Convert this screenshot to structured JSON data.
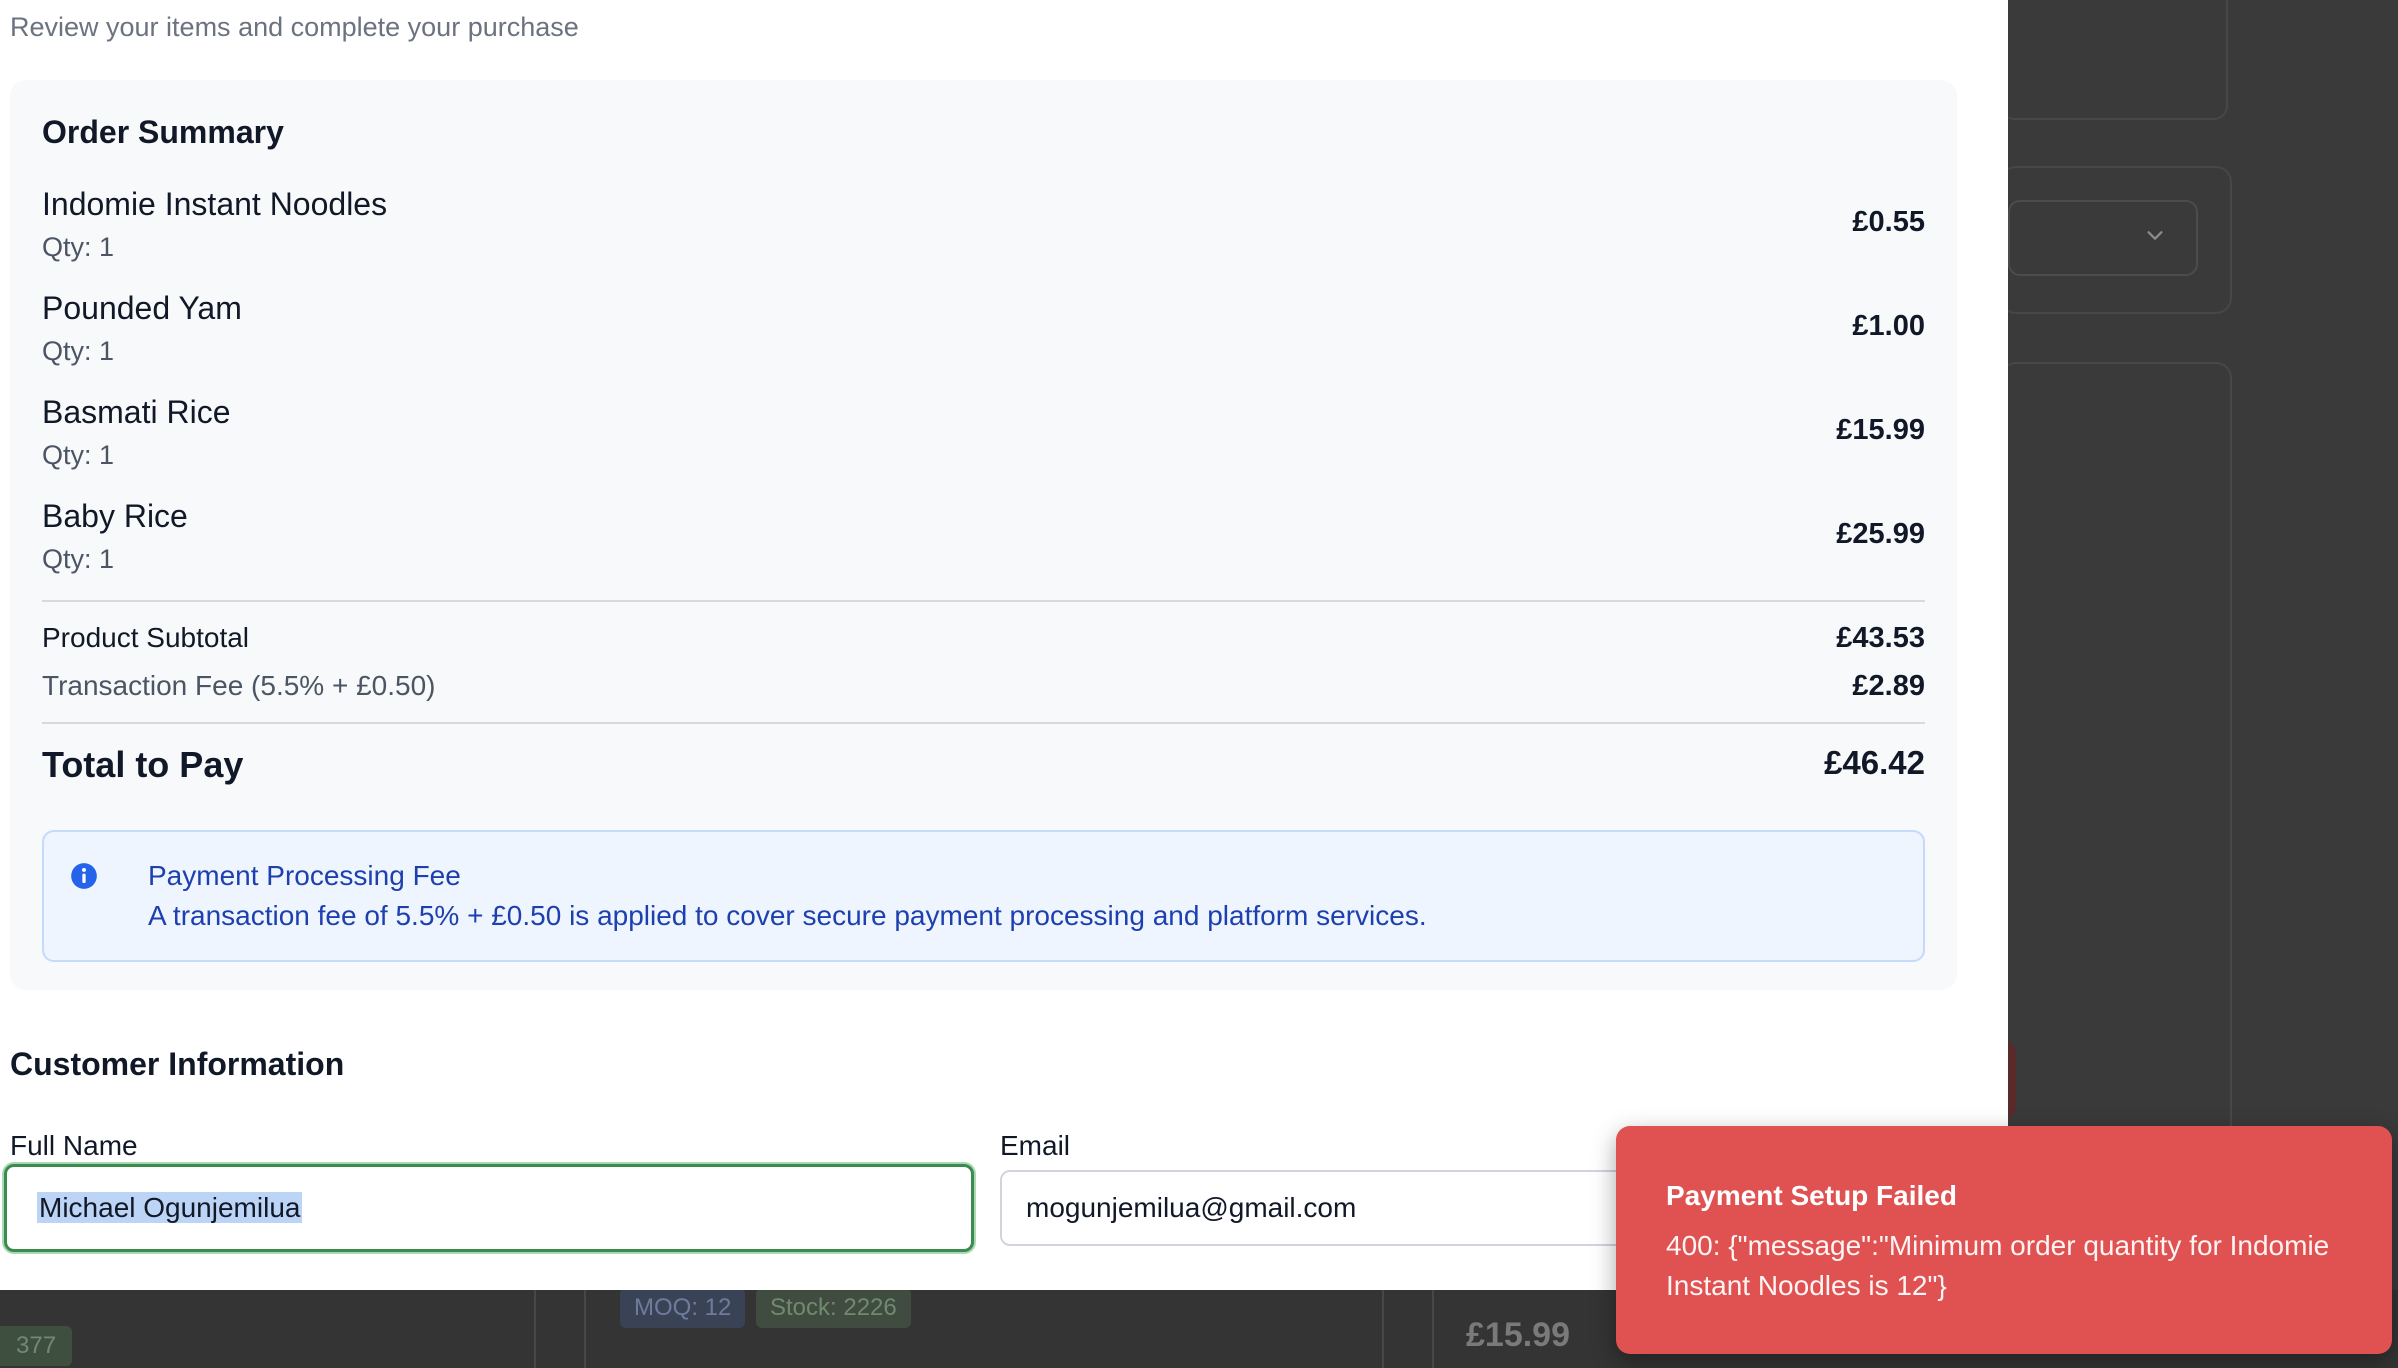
{
  "checkout": {
    "subtitle": "Review your items and complete your purchase",
    "summary_title": "Order Summary",
    "items": [
      {
        "name": "Indomie Instant Noodles",
        "qty": "Qty: 1",
        "price": "£0.55"
      },
      {
        "name": "Pounded Yam",
        "qty": "Qty: 1",
        "price": "£1.00"
      },
      {
        "name": "Basmati Rice",
        "qty": "Qty: 1",
        "price": "£15.99"
      },
      {
        "name": "Baby Rice",
        "qty": "Qty: 1",
        "price": "£25.99"
      }
    ],
    "subtotal_label": "Product Subtotal",
    "subtotal_value": "£43.53",
    "fee_label": "Transaction Fee (5.5% + £0.50)",
    "fee_value": "£2.89",
    "total_label": "Total to Pay",
    "total_value": "£46.42",
    "fee_notice": {
      "icon": "info-icon",
      "title": "Payment Processing Fee",
      "text": "A transaction fee of 5.5% + £0.50 is applied to cover secure payment processing and platform services."
    }
  },
  "customer": {
    "section_title": "Customer Information",
    "full_name_label": "Full Name",
    "full_name_value": "Michael Ogunjemilua",
    "email_label": "Email",
    "email_value": "mogunjemilua@gmail.com"
  },
  "toast": {
    "title": "Payment Setup Failed",
    "message": "400: {\"message\":\"Minimum order quantity for Indomie Instant Noodles is 12\"}",
    "color": "#e05252"
  },
  "background": {
    "stock_tag": "377",
    "moq_tag": "MOQ: 12",
    "stock2_tag": "Stock: 2226",
    "price": "£15.99"
  },
  "colors": {
    "focus_border": "#3b8a4e",
    "notice_text": "#1e40af",
    "notice_bg": "#eef5ff"
  }
}
